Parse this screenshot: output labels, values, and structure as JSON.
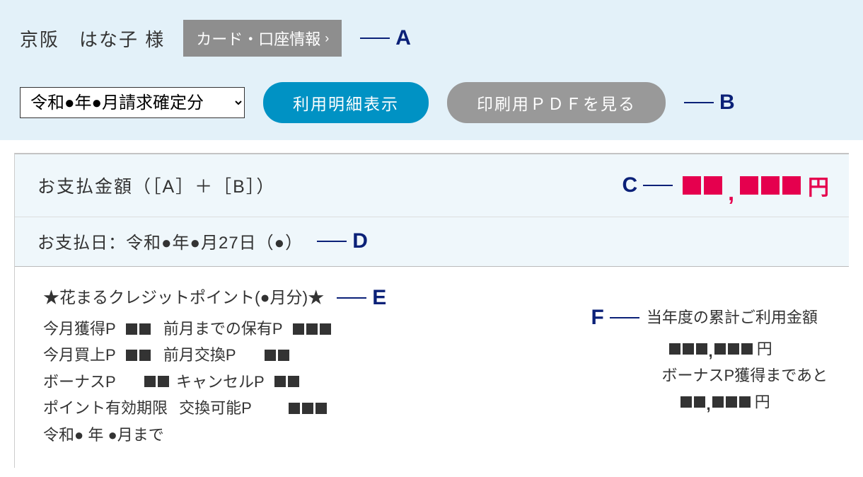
{
  "header": {
    "user_name": "京阪　はな子  様",
    "card_info_btn": "カード・口座情報",
    "annotation_a": "A"
  },
  "controls": {
    "period_option": "令和●年●月請求確定分",
    "show_detail_btn": "利用明細表示",
    "print_pdf_btn": "印刷用ＰＤＦを見る",
    "annotation_b": "B"
  },
  "payment": {
    "label": "お支払金額（［A］＋［B］）",
    "annotation_c": "C",
    "yen": "円"
  },
  "paydate": {
    "text": "お支払日：令和●年●月27日（●）",
    "annotation_d": "D"
  },
  "points": {
    "title": "★花まるクレジットポイント(●月分)★",
    "annotation_e": "E",
    "labels": {
      "gained": "今月獲得P",
      "prev_hold": "前月までの保有P",
      "purchase": "今月買上P",
      "prev_exchange": "前月交換P",
      "bonus": "ボーナスP",
      "cancel": "キャンセルP",
      "expiry_label": "ポイント有効期限",
      "exchangeable": "交換可能P",
      "expiry_value": "令和● 年  ●月まで"
    }
  },
  "right_panel": {
    "annotation_f": "F",
    "yearly_label": "当年度の累計ご利用金額",
    "yen": "円",
    "bonus_until_label": "ボーナスP獲得まであと"
  }
}
